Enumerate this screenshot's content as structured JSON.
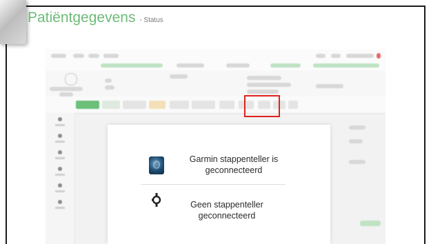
{
  "slide": {
    "title": "Patiëntgegevens",
    "subtitle": "- Status"
  },
  "dialog": {
    "items": [
      {
        "icon": "garmin-watch-icon",
        "label_line1": "Garmin stappenteller is",
        "label_line2": "geconnecteerd"
      },
      {
        "icon": "pedometer-disconnected-icon",
        "label_line1": "Geen stappenteller",
        "label_line2": "geconnecteerd"
      }
    ]
  },
  "colors": {
    "title": "#6dbb78",
    "highlight": "#e02020",
    "accent_green": "#bfe3c3"
  }
}
